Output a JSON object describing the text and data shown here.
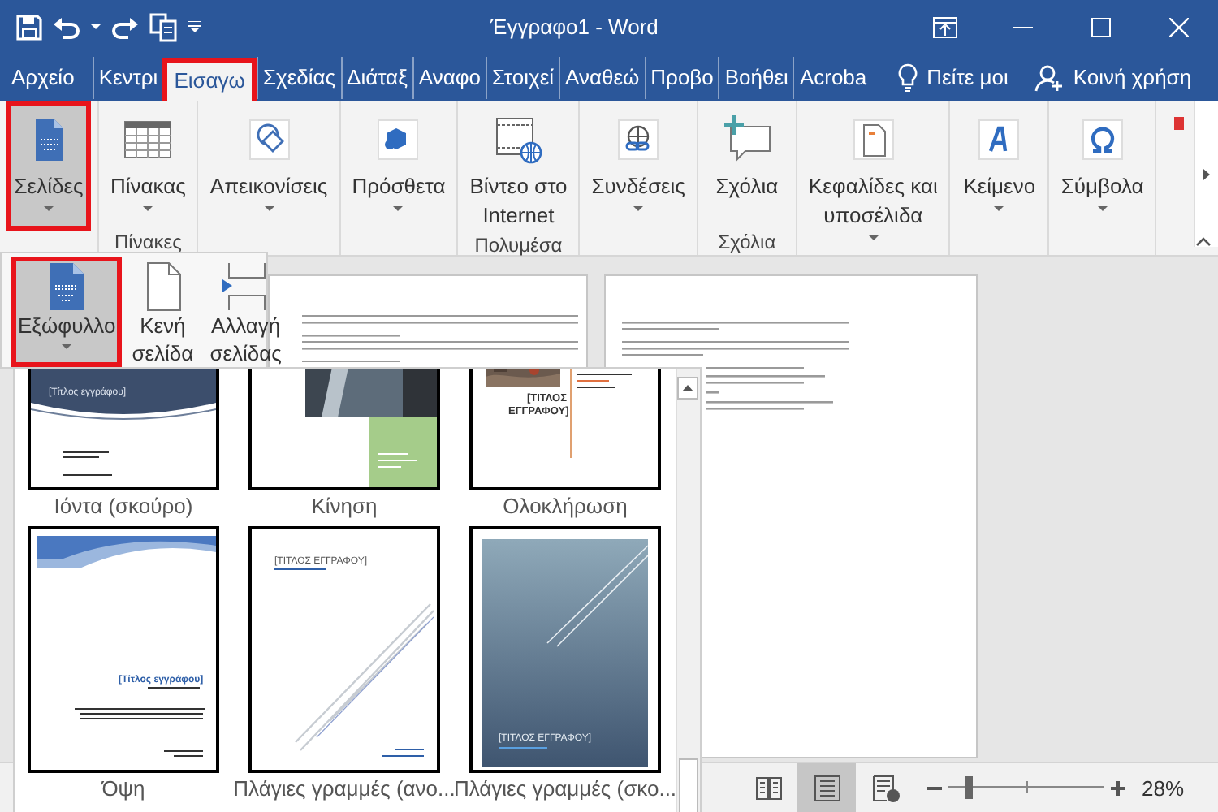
{
  "window": {
    "title": "Έγγραφο1 - Word"
  },
  "tabs": [
    {
      "label": "Αρχείο",
      "selected": false
    },
    {
      "label": "Κεντρι",
      "selected": false
    },
    {
      "label": "Εισαγω",
      "selected": true
    },
    {
      "label": "Σχεδίας",
      "selected": false
    },
    {
      "label": "Διάταξ",
      "selected": false
    },
    {
      "label": "Αναφο",
      "selected": false
    },
    {
      "label": "Στοιχεί",
      "selected": false
    },
    {
      "label": "Αναθεώ",
      "selected": false
    },
    {
      "label": "Προβο",
      "selected": false
    },
    {
      "label": "Βοήθει",
      "selected": false
    },
    {
      "label": "Acroba",
      "selected": false
    }
  ],
  "tell_me": "Πείτε μοι",
  "share": "Κοινή χρήση",
  "ribbon": {
    "groups": [
      {
        "buttons": [
          {
            "kind": "pages",
            "label": "Σελίδες",
            "dropdown": true,
            "selected": true
          }
        ]
      },
      {
        "label": "Πίνακες",
        "buttons": [
          {
            "kind": "table",
            "label": "Πίνακας",
            "dropdown": true,
            "selected": false
          }
        ]
      },
      {
        "buttons": [
          {
            "kind": "shapes",
            "label": "Απεικονίσεις",
            "dropdown": true,
            "selected": false
          }
        ]
      },
      {
        "buttons": [
          {
            "kind": "addins",
            "label": "Πρόσθετα",
            "dropdown": true,
            "selected": false
          }
        ]
      },
      {
        "label": "Πολυμέσα",
        "buttons": [
          {
            "kind": "video",
            "label": "Βίντεο στο\nInternet",
            "dropdown": false,
            "selected": false
          }
        ]
      },
      {
        "buttons": [
          {
            "kind": "links",
            "label": "Συνδέσεις",
            "dropdown": true,
            "selected": false
          }
        ]
      },
      {
        "label": "Σχόλια",
        "buttons": [
          {
            "kind": "comment",
            "label": "Σχόλια",
            "dropdown": false,
            "selected": false
          }
        ]
      },
      {
        "buttons": [
          {
            "kind": "header",
            "label": "Κεφαλίδες και\nυποσέλιδα",
            "dropdown": true,
            "selected": false
          }
        ]
      },
      {
        "buttons": [
          {
            "kind": "text",
            "label": "Κείμενο",
            "dropdown": true,
            "selected": false
          }
        ]
      },
      {
        "buttons": [
          {
            "kind": "symbol",
            "label": "Σύμβολα",
            "dropdown": true,
            "selected": false
          }
        ]
      }
    ]
  },
  "pages_menu": {
    "buttons": [
      {
        "kind": "cover",
        "label": "Εξώφυλλο",
        "dropdown": true,
        "selected": true
      },
      {
        "kind": "blank",
        "label": "Κενή σελίδα",
        "dropdown": false,
        "selected": false
      },
      {
        "kind": "break",
        "label": "Αλλαγή σελίδας",
        "dropdown": false,
        "selected": false
      }
    ]
  },
  "cover_gallery": {
    "items": [
      {
        "kind": "ion-dark",
        "name": "Ιόντα (σκούρο)",
        "title": "[Τίτλος εγγράφου]"
      },
      {
        "kind": "motion",
        "name": "Κίνηση"
      },
      {
        "kind": "integral",
        "name": "Ολοκλήρωση",
        "title": "[ΤΙΤΛΟΣ ΕΓΓΡΑΦΟΥ]"
      },
      {
        "kind": "facet",
        "name": "Όψη",
        "title": "[Τίτλος εγγράφου]"
      },
      {
        "kind": "slice-light",
        "name": "Πλάγιες γραμμές (ανο...",
        "title": "[ΤΙΤΛΟΣ ΕΓΓΡΑΦΟΥ]"
      },
      {
        "kind": "slice-dark",
        "name": "Πλάγιες γραμμές (σκο...",
        "title": "[ΤΙΤΛΟΣ ΕΓΓΡΑΦΟΥ]"
      }
    ]
  },
  "status_bar": {
    "views": [
      {
        "kind": "read",
        "selected": false
      },
      {
        "kind": "print",
        "selected": true
      },
      {
        "kind": "web",
        "selected": false
      }
    ],
    "zoom": {
      "level": 0.13,
      "reading": "28%"
    }
  }
}
